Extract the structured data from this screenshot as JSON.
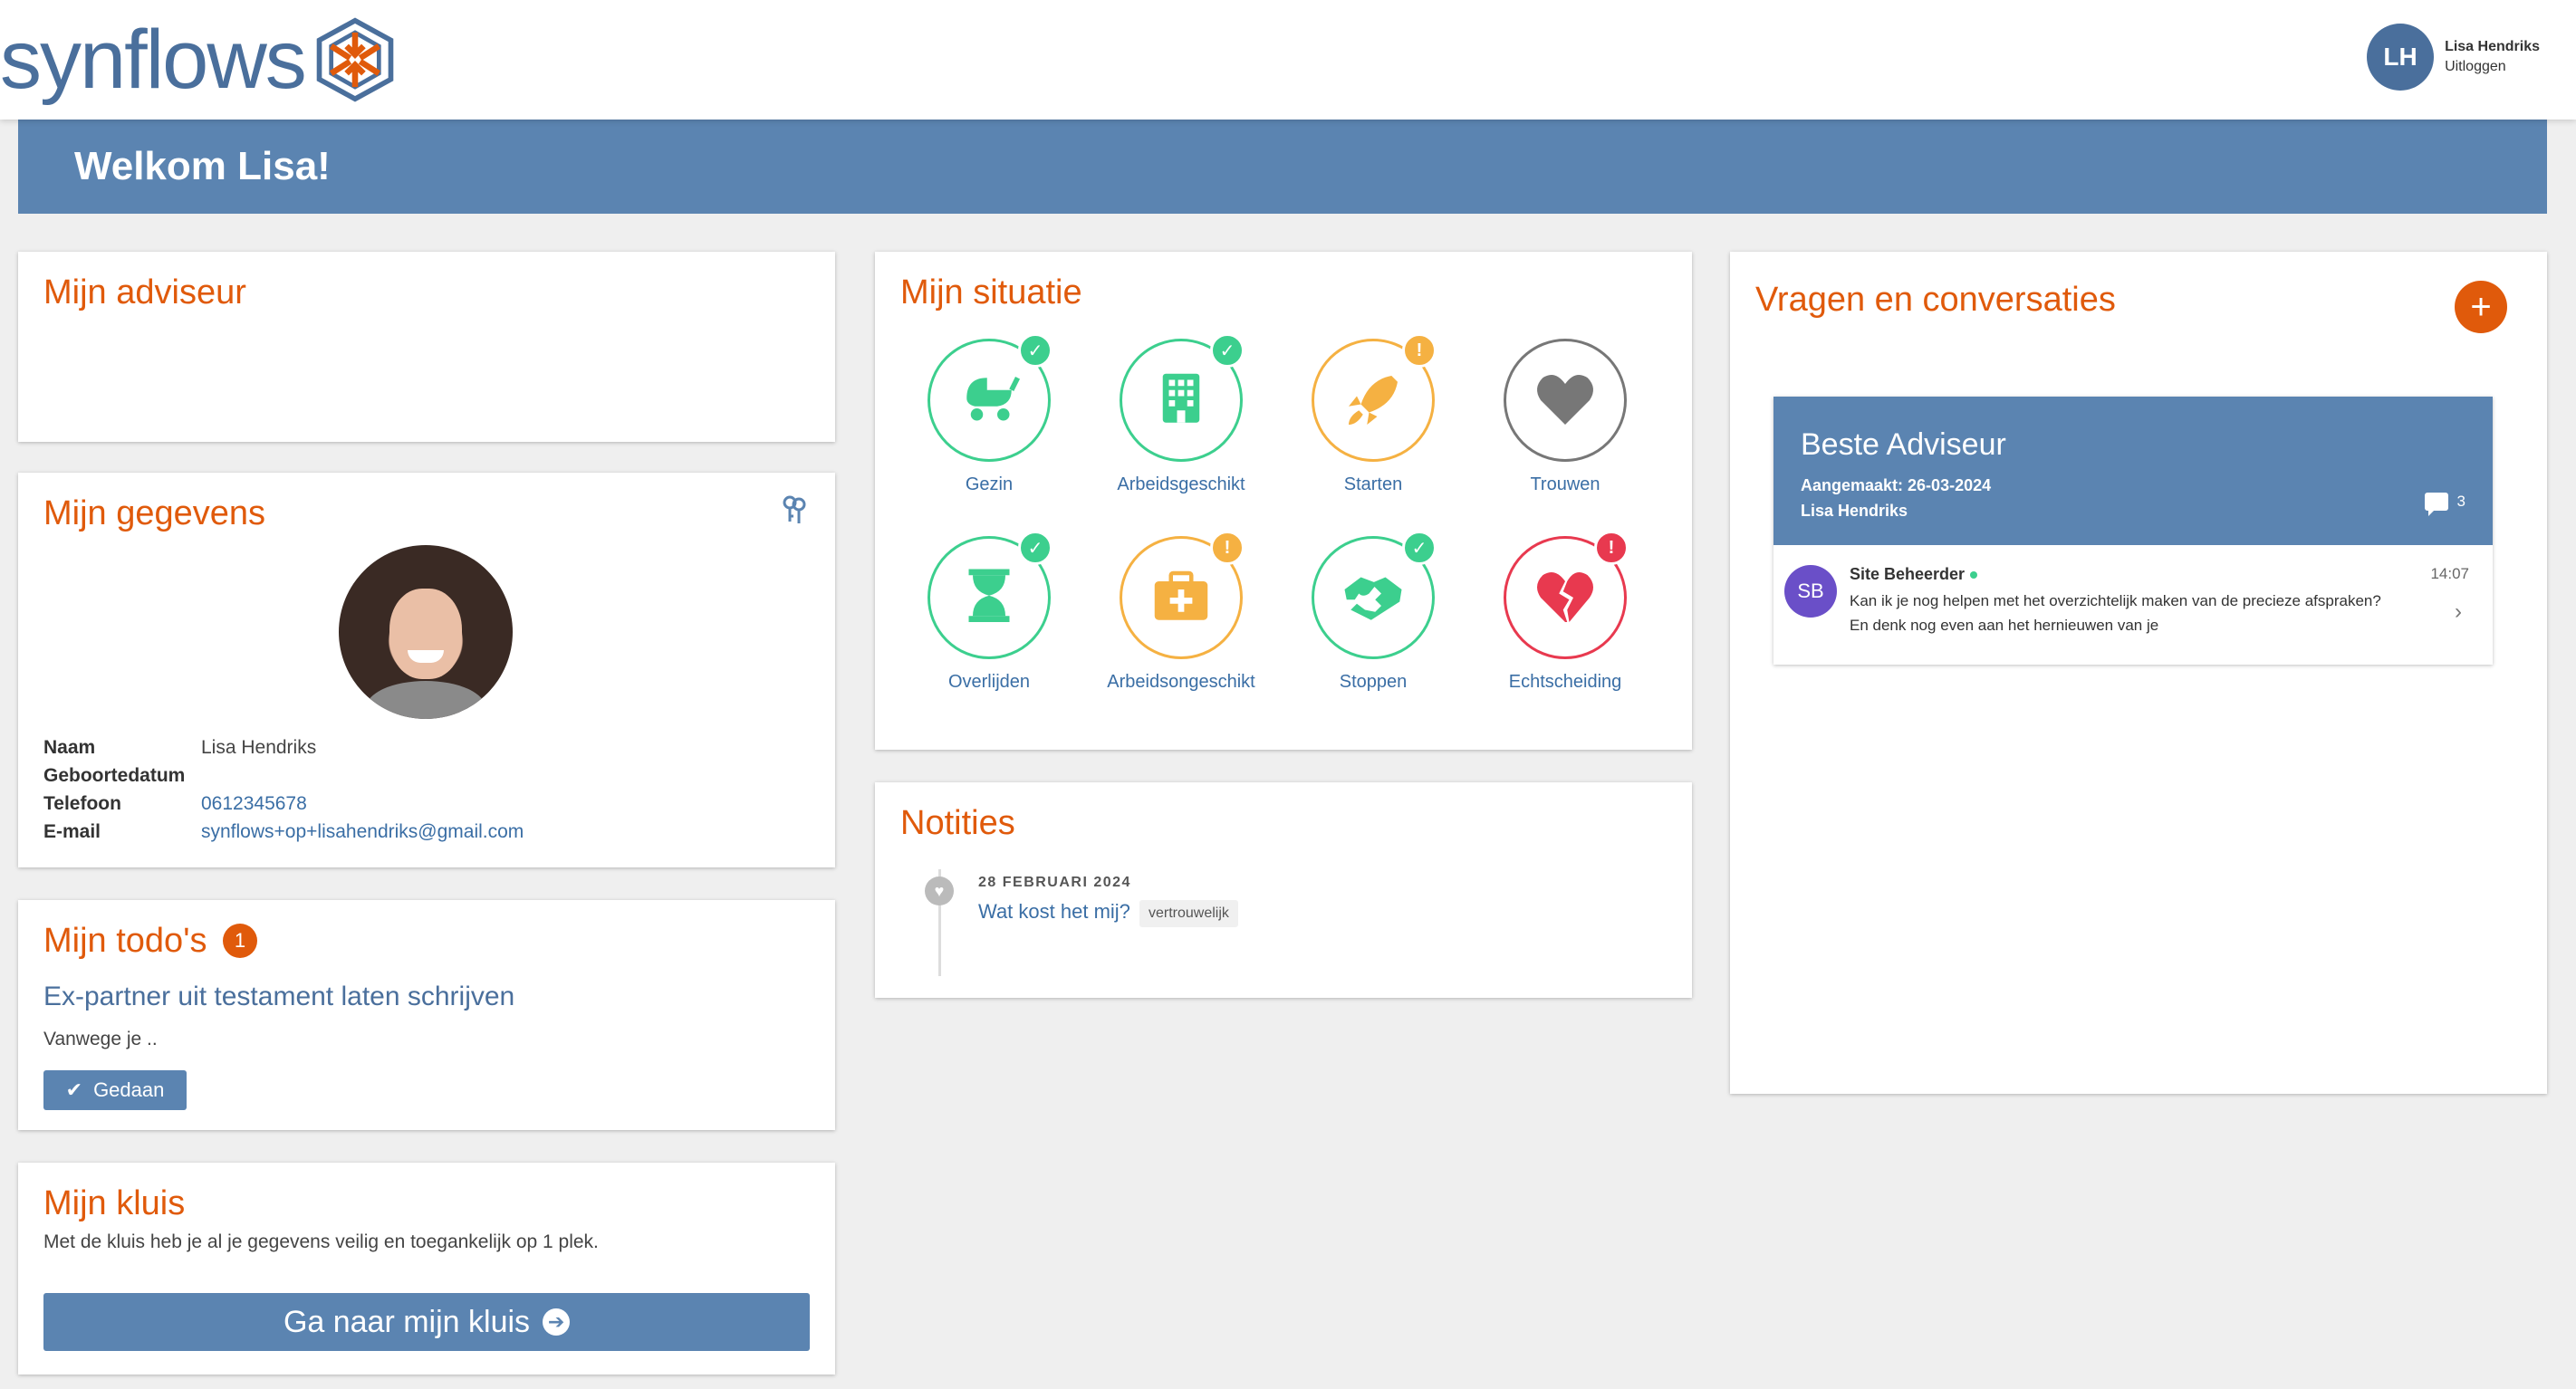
{
  "header": {
    "logo_text": "synflows",
    "user": {
      "initials": "LH",
      "name": "Lisa Hendriks",
      "logout_label": "Uitloggen"
    }
  },
  "banner": {
    "title": "Welkom Lisa!"
  },
  "adviseur": {
    "title": "Mijn adviseur"
  },
  "gegevens": {
    "title": "Mijn gegevens",
    "rows": [
      {
        "label": "Naam",
        "value": "Lisa Hendriks"
      },
      {
        "label": "Geboortedatum",
        "value": ""
      },
      {
        "label": "Telefoon",
        "value": "0612345678"
      },
      {
        "label": "E-mail",
        "value": "synflows+op+lisahendriks@gmail.com"
      }
    ]
  },
  "todo": {
    "title": "Mijn todo's",
    "count": "1",
    "item_title": "Ex-partner uit testament laten schrijven",
    "item_desc": "Vanwege je ..",
    "done_label": "Gedaan"
  },
  "kluis": {
    "title": "Mijn kluis",
    "description": "Met de kluis heb je al je gegevens veilig en toegankelijk op 1 plek.",
    "button_label": "Ga naar mijn kluis"
  },
  "situatie": {
    "title": "Mijn situatie",
    "items": [
      {
        "label": "Gezin",
        "status": "done",
        "icon": "stroller-icon"
      },
      {
        "label": "Arbeidsgeschikt",
        "status": "done",
        "icon": "building-icon"
      },
      {
        "label": "Starten",
        "status": "warning",
        "icon": "rocket-icon"
      },
      {
        "label": "Trouwen",
        "status": "none",
        "icon": "heart-icon"
      },
      {
        "label": "Overlijden",
        "status": "done",
        "icon": "hourglass-icon"
      },
      {
        "label": "Arbeidsongeschikt",
        "status": "warning",
        "icon": "medical-case-icon"
      },
      {
        "label": "Stoppen",
        "status": "done",
        "icon": "handshake-icon"
      },
      {
        "label": "Echtscheiding",
        "status": "alert",
        "icon": "broken-heart-icon"
      }
    ]
  },
  "notities": {
    "title": "Notities",
    "note": {
      "date": "28 FEBRUARI 2024",
      "title": "Wat kost het mij?",
      "tag": "vertrouwelijk"
    }
  },
  "vragen": {
    "title": "Vragen en conversaties",
    "add_label": "+",
    "conversation": {
      "title": "Beste Adviseur",
      "created": "Aangemaakt: 26-03-2024",
      "author": "Lisa Hendriks",
      "message_count": "3",
      "last_message": {
        "initials": "SB",
        "sender": "Site Beheerder",
        "time": "14:07",
        "text": "Kan ik je nog helpen met het overzichtelijk maken van de precieze afspraken? En denk nog even aan het hernieuwen van je"
      }
    }
  },
  "colors": {
    "brand_blue": "#5b84b1",
    "accent_orange": "#e05a0b",
    "done_green": "#3ccf8e",
    "warning_orange": "#f5b142",
    "alert_red": "#e8394f",
    "neutral_gray": "#777777"
  }
}
